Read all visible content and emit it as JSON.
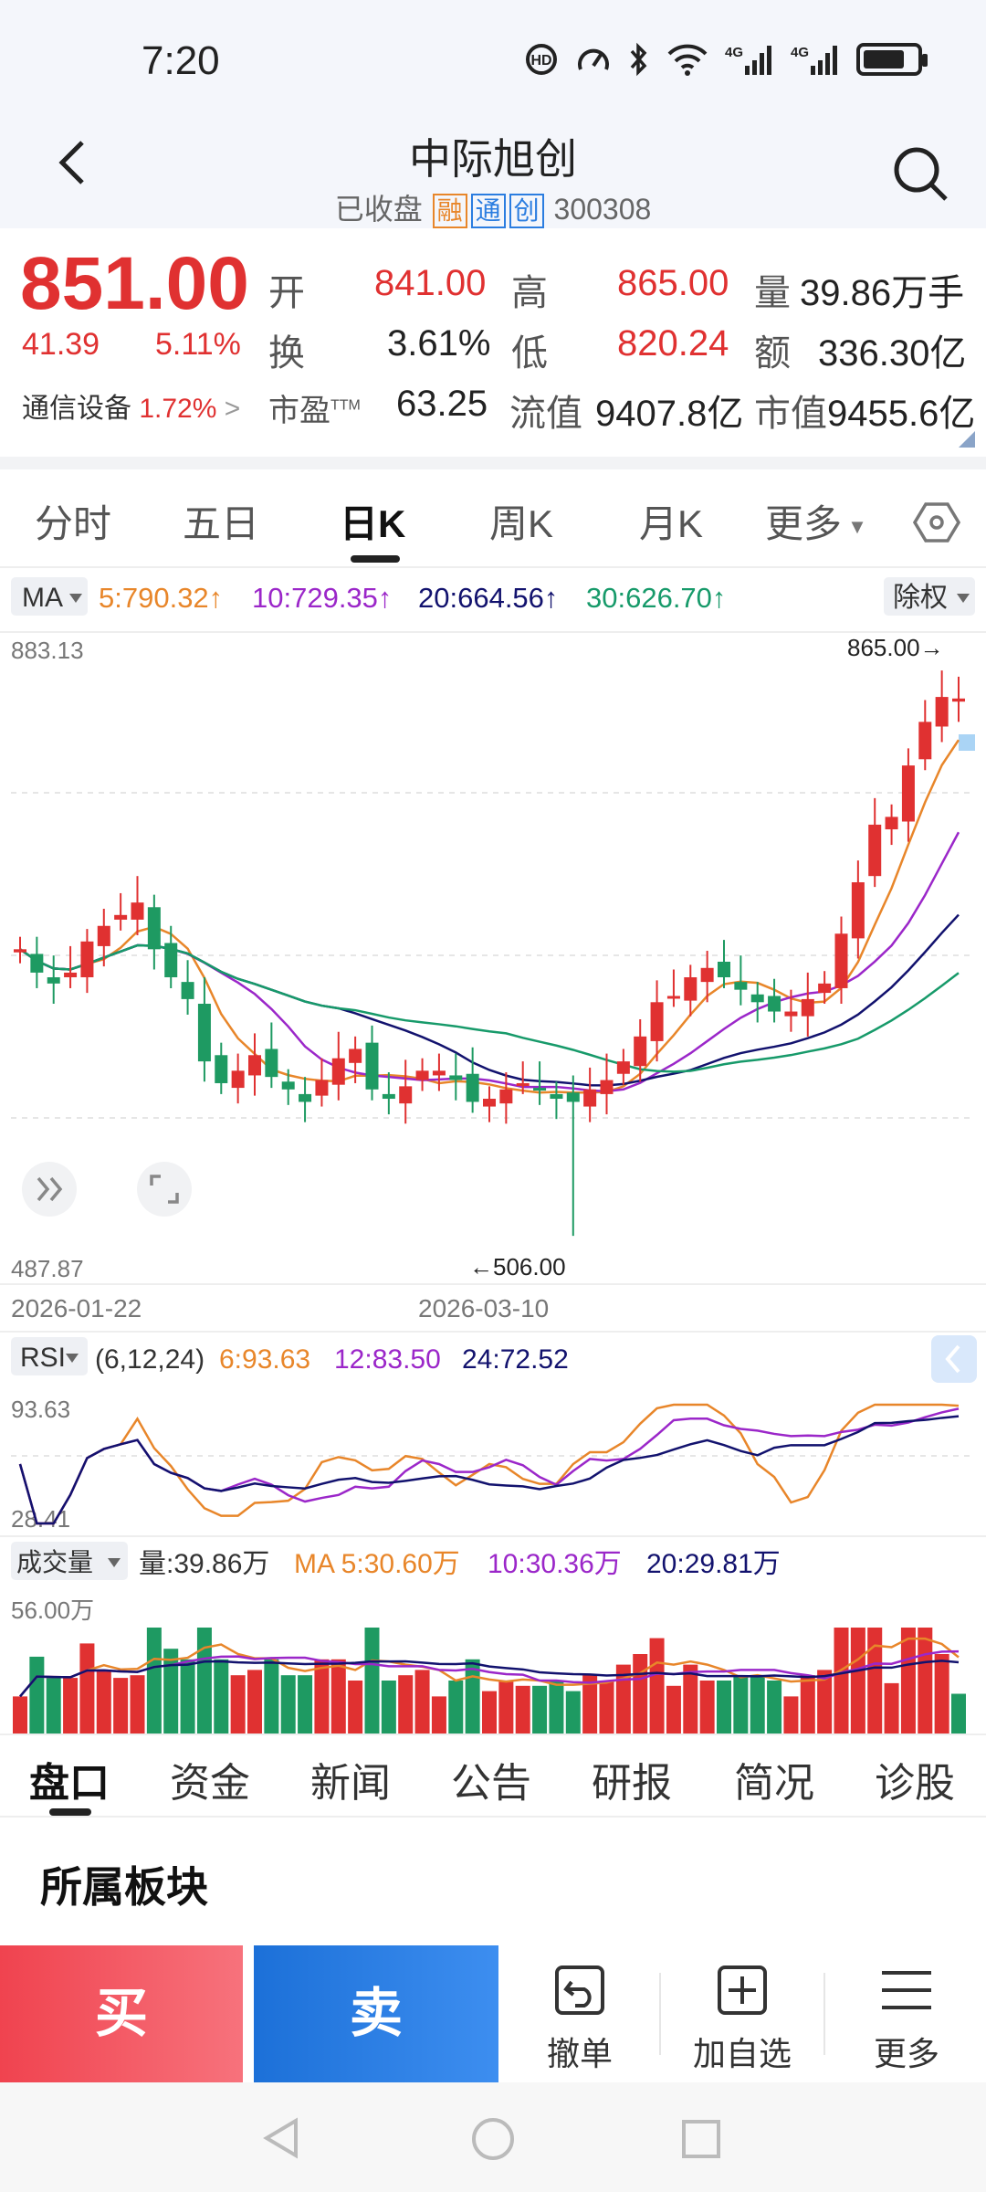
{
  "status_bar": {
    "time": "7:20",
    "icons": [
      "hd-icon",
      "speed-icon",
      "bluetooth-icon",
      "wifi-icon",
      "signal-4g-icon",
      "signal-4g-icon",
      "battery-charging-icon"
    ]
  },
  "header": {
    "title": "中际旭创",
    "status": "已收盘",
    "tags": [
      "融",
      "通",
      "创"
    ],
    "code": "300308"
  },
  "quote": {
    "price": "851.00",
    "change": "41.39",
    "change_pct": "5.11%",
    "sector_name": "通信设备",
    "sector_change": "1.72%",
    "open_label": "开",
    "open": "841.00",
    "high_label": "高",
    "high": "865.00",
    "volume_label": "量",
    "volume": "39.86万手",
    "turnover_label": "换",
    "turnover": "3.61%",
    "low_label": "低",
    "low": "820.24",
    "amount_label": "额",
    "amount": "336.30亿",
    "pe_label": "市盈",
    "pe_sup": "TTM",
    "pe": "63.25",
    "float_cap_label": "流值",
    "float_cap": "9407.8亿",
    "market_cap_label": "市值",
    "market_cap": "9455.6亿"
  },
  "period_tabs": [
    "分时",
    "五日",
    "日K",
    "周K",
    "月K",
    "更多"
  ],
  "active_period": "日K",
  "ma_bar": {
    "selector": "MA",
    "ma5": "5:790.32↑",
    "ma10": "10:729.35↑",
    "ma20": "20:664.56↑",
    "ma30": "30:626.70↑",
    "adjust": "除权"
  },
  "kline": {
    "y_max_label": "883.13",
    "y_min_label": "487.87",
    "high_annotation": "865.00→",
    "low_annotation": "←506.00",
    "date_start": "2026-01-22",
    "date_mid": "2026-03-10"
  },
  "rsi": {
    "selector": "RSI",
    "params": "(6,12,24)",
    "rsi6": "6:93.63",
    "rsi12": "12:83.50",
    "rsi24": "24:72.52",
    "y_max_label": "93.63",
    "y_min_label": "28.41"
  },
  "volume": {
    "selector": "成交量",
    "current": "量:39.86万",
    "ma5": "MA 5:30.60万",
    "ma10": "10:30.36万",
    "ma20": "20:29.81万",
    "y_max_label": "56.00万"
  },
  "colors": {
    "up": "#e03131",
    "down": "#1e9a62",
    "ma5": "#e8862a",
    "ma10": "#9b27c9",
    "ma20": "#12126e",
    "ma30": "#179a6a"
  },
  "chart_data": {
    "type": "candlestick",
    "title": "",
    "ohlc_close_approx": [
      690,
      675,
      668,
      675,
      695,
      705,
      712,
      720,
      690,
      672,
      658,
      618,
      604,
      612,
      622,
      608,
      600,
      592,
      606,
      620,
      626,
      600,
      594,
      602,
      612,
      612,
      606,
      592,
      594,
      600,
      604,
      600,
      594,
      592,
      600,
      606,
      618,
      634,
      656,
      660,
      672,
      678,
      672,
      664,
      656,
      650,
      650,
      658,
      668,
      700,
      733,
      770,
      775,
      808,
      836,
      852,
      851
    ],
    "visible_high": 865.0,
    "visible_low": 506.0,
    "y_range": [
      487.87,
      883.13
    ],
    "x_start": "2026-01-22",
    "x_mid": "2026-03-10"
  },
  "info_tabs": [
    "盘口",
    "资金",
    "新闻",
    "公告",
    "研报",
    "简况",
    "诊股"
  ],
  "active_info_tab": "盘口",
  "section_title": "所属板块",
  "actions": {
    "buy": "买",
    "sell": "卖",
    "cancel_order": "撤单",
    "add_watch": "加自选",
    "more": "更多"
  }
}
